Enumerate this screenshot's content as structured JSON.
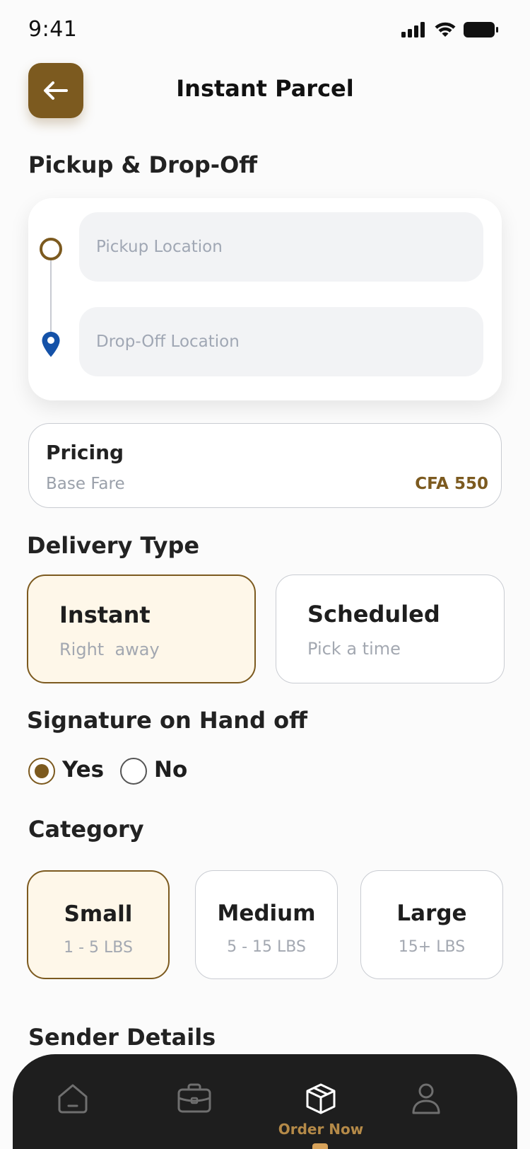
{
  "status_bar": {
    "time": "9:41"
  },
  "header": {
    "title": "Instant Parcel"
  },
  "route": {
    "section_title": "Pickup & Drop-Off",
    "pickup_placeholder": "Pickup Location",
    "dropoff_placeholder": "Drop-Off Location"
  },
  "pricing": {
    "title": "Pricing",
    "base_fare_label": "Base Fare",
    "base_fare_value": "CFA 550"
  },
  "delivery_type": {
    "section_title": "Delivery Type",
    "options": [
      {
        "title": "Instant",
        "subtitle": "Right  away",
        "selected": true
      },
      {
        "title": "Scheduled",
        "subtitle": "Pick a time",
        "selected": false
      }
    ]
  },
  "signature": {
    "section_title": "Signature on Hand off",
    "options": [
      {
        "label": "Yes",
        "checked": true
      },
      {
        "label": "No",
        "checked": false
      }
    ]
  },
  "category": {
    "section_title": "Category",
    "options": [
      {
        "title": "Small",
        "subtitle": "1 - 5 LBS",
        "selected": true
      },
      {
        "title": "Medium",
        "subtitle": "5 - 15 LBS",
        "selected": false
      },
      {
        "title": "Large",
        "subtitle": "15+ LBS",
        "selected": false
      }
    ]
  },
  "sender": {
    "section_title": "Sender Details"
  },
  "bottom_nav": {
    "items": [
      {
        "icon": "home-icon",
        "label": ""
      },
      {
        "icon": "briefcase-icon",
        "label": ""
      },
      {
        "icon": "package-icon",
        "label": "Order Now",
        "active": true
      },
      {
        "icon": "user-icon",
        "label": ""
      }
    ]
  },
  "colors": {
    "accent": "#7c5a1f",
    "selected_bg": "#fef7e9",
    "nav_bg": "#1e1e1e",
    "nav_active_label": "#b58a48",
    "pin_blue": "#1552a8"
  }
}
